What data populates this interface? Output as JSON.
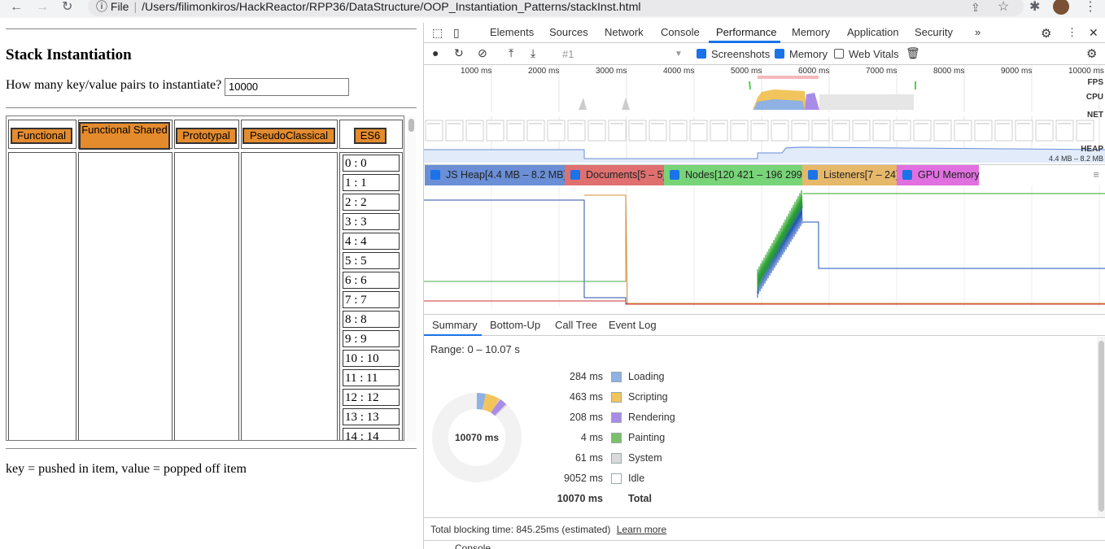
{
  "browser": {
    "file_label": "File",
    "url": "/Users/filimonkiros/HackReactor/RPP36/DataStructure/OOP_Instantiation_Patterns/stackInst.html"
  },
  "page": {
    "title": "Stack Instantiation",
    "prompt": "How many key/value pairs to instantiate?",
    "count_value": "10000",
    "buttons": [
      "Functional",
      "Functional Shared",
      "Prototypal",
      "PseudoClassical",
      "ES6"
    ],
    "es6_values": [
      "0 : 0",
      "1 : 1",
      "2 : 2",
      "3 : 3",
      "4 : 4",
      "5 : 5",
      "6 : 6",
      "7 : 7",
      "8 : 8",
      "9 : 9",
      "10 : 10",
      "11 : 11",
      "12 : 12",
      "13 : 13",
      "14 : 14"
    ],
    "legend": "key = pushed in item, value = popped off item"
  },
  "devtools": {
    "tabs": [
      "Elements",
      "Sources",
      "Network",
      "Console",
      "Performance",
      "Memory",
      "Application",
      "Security"
    ],
    "active_tab": "Performance",
    "more_tabs": "»",
    "recording_label": "#1",
    "toggles": {
      "screenshots": "Screenshots",
      "memory": "Memory",
      "web_vitals": "Web Vitals"
    },
    "ruler_labels": [
      "1000 ms",
      "2000 ms",
      "3000 ms",
      "4000 ms",
      "5000 ms",
      "6000 ms",
      "7000 ms",
      "8000 ms",
      "9000 ms",
      "10000 ms"
    ],
    "track_labels": {
      "fps": "FPS",
      "cpu": "CPU",
      "net": "NET",
      "heap": "HEAP",
      "heap_range": "4.4 MB – 8.2 MB"
    },
    "memory_counters": [
      {
        "label": "JS Heap[4.4 MB – 8.2 MB]",
        "color": "#6a8fd6"
      },
      {
        "label": "Documents[5 – 5]",
        "color": "#e07070"
      },
      {
        "label": "Nodes[120 421 – 196 299]",
        "color": "#77d477"
      },
      {
        "label": "Listeners[7 – 24]",
        "color": "#e6b86a"
      },
      {
        "label": "GPU Memory",
        "color": "#e070e0"
      }
    ],
    "subtabs": [
      "Summary",
      "Bottom-Up",
      "Call Tree",
      "Event Log"
    ],
    "range": "Range: 0 – 10.07 s",
    "donut_total": "10070 ms",
    "summary": [
      {
        "value": "284 ms",
        "label": "Loading",
        "color": "#8fb1e3"
      },
      {
        "value": "463 ms",
        "label": "Scripting",
        "color": "#f2c55c"
      },
      {
        "value": "208 ms",
        "label": "Rendering",
        "color": "#a98ce8"
      },
      {
        "value": "4 ms",
        "label": "Painting",
        "color": "#7bbf6a"
      },
      {
        "value": "61 ms",
        "label": "System",
        "color": "#dadada"
      },
      {
        "value": "9052 ms",
        "label": "Idle",
        "color": "#ffffff"
      },
      {
        "value": "10070 ms",
        "label": "Total",
        "color": ""
      }
    ],
    "tbt": "Total blocking time: 845.25ms (estimated)",
    "learn_more": "Learn more",
    "console_label": "Console"
  }
}
